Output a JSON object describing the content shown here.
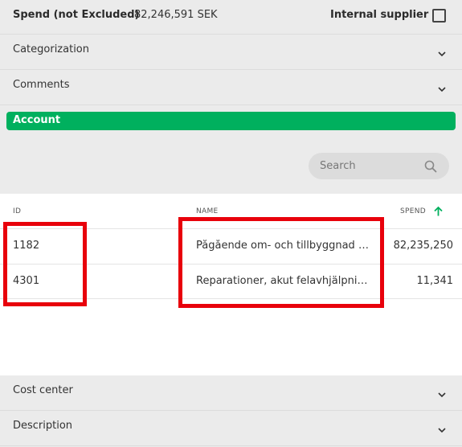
{
  "header": {
    "spend_label": "Spend (not Excluded)",
    "spend_value": "82,246,591 SEK",
    "internal_supplier_label": "Internal supplier",
    "internal_supplier_checked": false
  },
  "sections": {
    "categorization": "Categorization",
    "comments": "Comments",
    "cost_center": "Cost center",
    "description": "Description"
  },
  "account": {
    "title": "Account",
    "search_placeholder": "Search",
    "columns": {
      "id": "ID",
      "name": "NAME",
      "spend": "SPEND"
    },
    "rows": [
      {
        "id": "1182",
        "name": "Pågående om- och tillbyggnad (1...",
        "spend": "82,235,250"
      },
      {
        "id": "4301",
        "name": "Reparationer, akut felavhjälpning...",
        "spend": "11,341"
      }
    ]
  },
  "colors": {
    "accent": "#00b05e",
    "highlight": "#e8000b"
  }
}
